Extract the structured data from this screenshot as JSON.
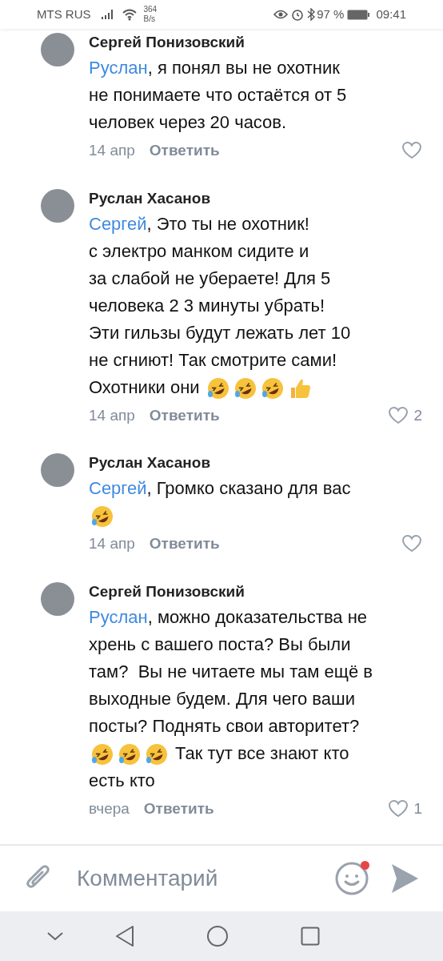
{
  "status_bar": {
    "carrier": "MTS RUS",
    "speed_value": "364",
    "speed_unit": "B/s",
    "battery_percent": "97 %",
    "time": "09:41"
  },
  "comments": [
    {
      "author": "Сергей Понизовский",
      "parts": [
        {
          "kind": "mention",
          "text": "Руслан"
        },
        {
          "kind": "text",
          "text": ", я понял вы не охотник\nне понимаете что остаётся от 5\nчеловек через 20 часов."
        }
      ],
      "date": "14 апр",
      "reply": "Ответить"
    },
    {
      "author": "Руслан Хасанов",
      "parts": [
        {
          "kind": "mention",
          "text": "Сергей"
        },
        {
          "kind": "text",
          "text": ", Это ты не охотник!\nс электро манком сидите и\nза слабой не убераете! Для 5\nчеловека 2 3 минуты убрать!\nЭти гильзы будут лежать лет 10\nне сгниют! Так смотрите сами!\nОхотники они "
        },
        {
          "kind": "rofl_emoji"
        },
        {
          "kind": "rofl_emoji"
        },
        {
          "kind": "rofl_emoji"
        },
        {
          "kind": "thumbs_up_emoji"
        }
      ],
      "date": "14 апр",
      "reply": "Ответить",
      "likes": "2"
    },
    {
      "author": "Руслан Хасанов",
      "parts": [
        {
          "kind": "mention",
          "text": "Сергей"
        },
        {
          "kind": "text",
          "text": ", Громко сказано для вас\n"
        },
        {
          "kind": "rofl_emoji"
        }
      ],
      "date": "14 апр",
      "reply": "Ответить"
    },
    {
      "author": "Сергей Понизовский",
      "parts": [
        {
          "kind": "mention",
          "text": "Руслан"
        },
        {
          "kind": "text",
          "text": ", можно доказательства не\nхрень с вашего поста? Вы были\nтам?  Вы не читаете мы там ещё в\nвыходные будем. Для чего ваши\nпосты? Поднять свои авторитет?\n"
        },
        {
          "kind": "rofl_emoji"
        },
        {
          "kind": "rofl_emoji"
        },
        {
          "kind": "rofl_emoji"
        },
        {
          "kind": "text",
          "text": " Так тут все знают кто\nесть кто"
        }
      ],
      "date": "вчера",
      "reply": "Ответить",
      "likes": "1"
    }
  ],
  "composer": {
    "placeholder": "Комментарий",
    "emoji_notification": true
  }
}
